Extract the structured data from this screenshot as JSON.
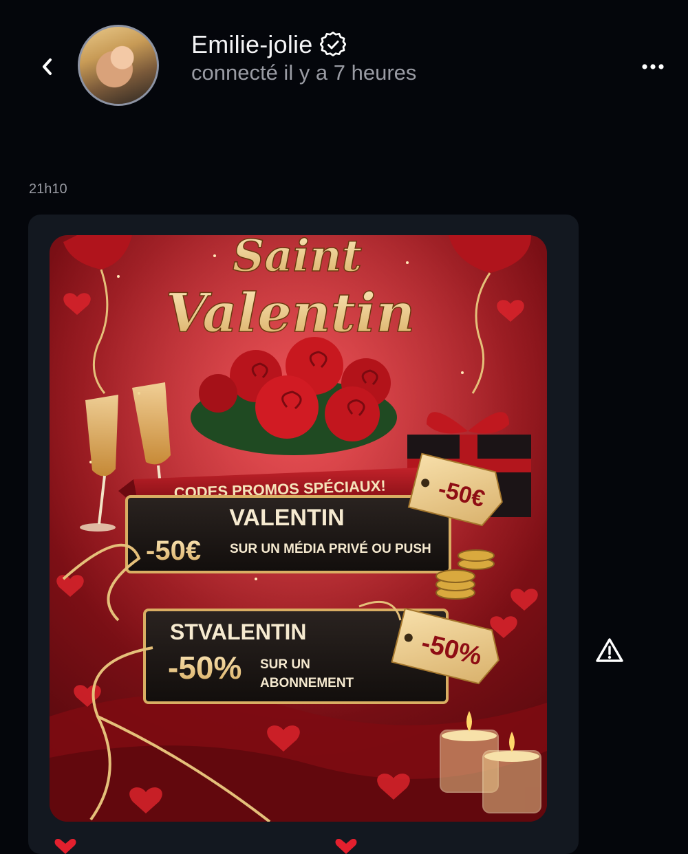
{
  "header": {
    "name": "Emilie-jolie",
    "status": "connecté il y a 7 heures",
    "back_icon": "chevron-left-icon",
    "verified_icon": "verified-badge-icon",
    "more_icon": "more-horizontal-icon"
  },
  "message": {
    "time": "21h10",
    "poster": {
      "title_line1": "Saint",
      "title_line2": "Valentin",
      "banner": "CODES PROMOS SPÉCIAUX!",
      "code1": "VALENTIN",
      "code1_discount": "-50€",
      "code1_desc": "SUR UN MÉDIA PRIVÉ OU PUSH",
      "tag1": "-50€",
      "code2": "STVALENTIN",
      "code2_discount": "-50%",
      "code2_desc_line1": "SUR UN",
      "code2_desc_line2": "ABONNEMENT",
      "tag2": "-50%"
    },
    "warning_icon": "warning-triangle-icon"
  },
  "colors": {
    "background": "#04060b",
    "bubble": "#131820",
    "muted_text": "#9a9ca4",
    "gold": "#f1d39a",
    "poster_red": "#9b1219"
  }
}
